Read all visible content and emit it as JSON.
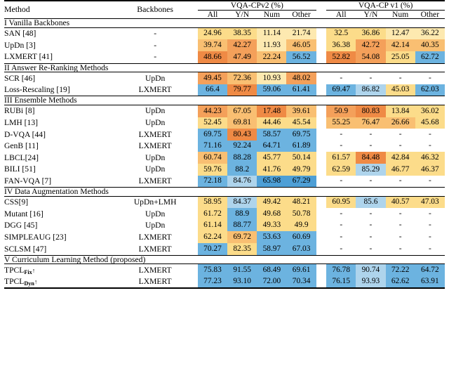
{
  "table": {
    "columns": {
      "method": "Method",
      "backbones": "Backbones",
      "group1": "VQA-CPv2 (%)",
      "group2": "VQA-CP v1 (%)",
      "sub": [
        "All",
        "Y/N",
        "Num",
        "Other"
      ]
    },
    "palette": {
      "yellow_light": "#fde9b0",
      "yellow": "#fcdc8a",
      "orange_light": "#f9bf72",
      "orange": "#f4a05a",
      "orange_deep": "#ef8a45",
      "blue_light": "#aed4ec",
      "blue": "#6cb3e0",
      "blue_deep": "#4e9fd6",
      "none": "transparent"
    },
    "sections": [
      {
        "title": "I Vanilla Backbones",
        "rows": [
          {
            "method": "SAN [48]",
            "backbone": "-",
            "v2": [
              "24.96",
              "38.35",
              "11.14",
              "21.74"
            ],
            "v2c": [
              "yellow",
              "yellow",
              "yellow_light",
              "yellow_light"
            ],
            "v1": [
              "32.5",
              "36.86",
              "12.47",
              "36.22"
            ],
            "v1c": [
              "yellow",
              "yellow",
              "yellow_light",
              "yellow_light"
            ]
          },
          {
            "method": "UpDn [3]",
            "backbone": "-",
            "v2": [
              "39.74",
              "42.27",
              "11.93",
              "46.05"
            ],
            "v2c": [
              "orange_light",
              "orange",
              "yellow_light",
              "orange_light"
            ],
            "v1": [
              "36.38",
              "42.72",
              "42.14",
              "40.35"
            ],
            "v1c": [
              "yellow",
              "orange",
              "orange_light",
              "orange_light"
            ]
          },
          {
            "method": "LXMERT [41]",
            "backbone": "-",
            "v2": [
              "48.66",
              "47.49",
              "22.24",
              "56.52"
            ],
            "v2c": [
              "orange_deep",
              "orange",
              "orange_light",
              "blue"
            ],
            "v1": [
              "52.82",
              "54.08",
              "25.05",
              "62.72"
            ],
            "v1c": [
              "orange_deep",
              "orange",
              "yellow",
              "blue"
            ]
          }
        ]
      },
      {
        "title": "II Answer Re-Ranking Methods",
        "rows": [
          {
            "method": "SCR [46]",
            "backbone": "UpDn",
            "v2": [
              "49.45",
              "72.36",
              "10.93",
              "48.02"
            ],
            "v2c": [
              "orange",
              "orange_light",
              "yellow_light",
              "orange"
            ],
            "v1": [
              "-",
              "-",
              "-",
              "-"
            ],
            "v1c": [
              "none",
              "none",
              "none",
              "none"
            ]
          },
          {
            "method": "Loss-Rescaling [19]",
            "backbone": "LXMERT",
            "v2": [
              "66.4",
              "79.77",
              "59.06",
              "61.41"
            ],
            "v2c": [
              "blue",
              "orange_deep",
              "blue",
              "blue"
            ],
            "v1": [
              "69.47",
              "86.82",
              "45.03",
              "62.03"
            ],
            "v1c": [
              "blue",
              "blue_light",
              "yellow",
              "blue"
            ]
          }
        ]
      },
      {
        "title": "III Ensemble Methods",
        "rows": [
          {
            "method": "RUBi [8]",
            "backbone": "UpDn",
            "v2": [
              "44.23",
              "67.05",
              "17.48",
              "39.61"
            ],
            "v2c": [
              "orange",
              "orange_light",
              "orange_deep",
              "orange_light"
            ],
            "v1": [
              "50.9",
              "80.83",
              "13.84",
              "36.02"
            ],
            "v1c": [
              "orange",
              "orange_deep",
              "yellow",
              "yellow"
            ]
          },
          {
            "method": "LMH [13]",
            "backbone": "UpDn",
            "v2": [
              "52.45",
              "69.81",
              "44.46",
              "45.54"
            ],
            "v2c": [
              "yellow",
              "orange_light",
              "yellow",
              "yellow"
            ],
            "v1": [
              "55.25",
              "76.47",
              "26.66",
              "45.68"
            ],
            "v1c": [
              "orange_light",
              "orange_light",
              "orange_light",
              "yellow"
            ]
          },
          {
            "method": "D-VQA [44]",
            "backbone": "LXMERT",
            "v2": [
              "69.75",
              "80.43",
              "58.57",
              "69.75"
            ],
            "v2c": [
              "blue",
              "orange_deep",
              "blue",
              "blue"
            ],
            "v1": [
              "-",
              "-",
              "-",
              "-"
            ],
            "v1c": [
              "none",
              "none",
              "none",
              "none"
            ]
          },
          {
            "method": "GenB [11]",
            "backbone": "LXMERT",
            "v2": [
              "71.16",
              "92.24",
              "64.71",
              "61.89"
            ],
            "v2c": [
              "blue",
              "blue",
              "blue",
              "blue"
            ],
            "v1": [
              "-",
              "-",
              "-",
              "-"
            ],
            "v1c": [
              "none",
              "none",
              "none",
              "none"
            ]
          },
          {
            "method": "LBCL[24]",
            "backbone": "UpDn",
            "v2": [
              "60.74",
              "88.28",
              "45.77",
              "50.14"
            ],
            "v2c": [
              "orange_light",
              "blue",
              "yellow",
              "yellow"
            ],
            "v1": [
              "61.57",
              "84.48",
              "42.84",
              "46.32"
            ],
            "v1c": [
              "yellow",
              "orange_deep",
              "yellow",
              "yellow"
            ]
          },
          {
            "method": "BILI [51]",
            "backbone": "UpDn",
            "v2": [
              "59.76",
              "88.2",
              "41.76",
              "49.79"
            ],
            "v2c": [
              "yellow",
              "blue",
              "yellow",
              "yellow"
            ],
            "v1": [
              "62.59",
              "85.29",
              "46.77",
              "46.37"
            ],
            "v1c": [
              "yellow",
              "blue_light",
              "yellow",
              "yellow"
            ]
          },
          {
            "method": "FAN-VQA [7]",
            "backbone": "LXMERT",
            "v2": [
              "72.18",
              "84.76",
              "65.98",
              "67.29"
            ],
            "v2c": [
              "blue",
              "blue_light",
              "blue_deep",
              "blue_deep"
            ],
            "v1": [
              "-",
              "-",
              "-",
              "-"
            ],
            "v1c": [
              "none",
              "none",
              "none",
              "none"
            ]
          }
        ]
      },
      {
        "title": "IV Data Augmentation Methods",
        "rows": [
          {
            "method": "CSS[9]",
            "backbone": "UpDn+LMH",
            "v2": [
              "58.95",
              "84.37",
              "49.42",
              "48.21"
            ],
            "v2c": [
              "yellow",
              "blue_light",
              "yellow",
              "yellow"
            ],
            "v1": [
              "60.95",
              "85.6",
              "40.57",
              "47.03"
            ],
            "v1c": [
              "yellow",
              "blue_light",
              "yellow",
              "yellow"
            ]
          },
          {
            "method": "Mutant [16]",
            "backbone": "UpDn",
            "v2": [
              "61.72",
              "88.9",
              "49.68",
              "50.78"
            ],
            "v2c": [
              "yellow",
              "blue",
              "yellow",
              "yellow"
            ],
            "v1": [
              "-",
              "-",
              "-",
              "-"
            ],
            "v1c": [
              "none",
              "none",
              "none",
              "none"
            ]
          },
          {
            "method": "DGG [45]",
            "backbone": "UpDn",
            "v2": [
              "61.14",
              "88.77",
              "49.33",
              "49.9"
            ],
            "v2c": [
              "yellow",
              "blue",
              "yellow",
              "yellow"
            ],
            "v1": [
              "-",
              "-",
              "-",
              "-"
            ],
            "v1c": [
              "none",
              "none",
              "none",
              "none"
            ]
          },
          {
            "method": "SIMPLEAUG [23]",
            "backbone": "LXMERT",
            "v2": [
              "62.24",
              "69.72",
              "53.63",
              "60.69"
            ],
            "v2c": [
              "yellow",
              "orange_light",
              "blue",
              "blue"
            ],
            "v1": [
              "-",
              "-",
              "-",
              "-"
            ],
            "v1c": [
              "none",
              "none",
              "none",
              "none"
            ]
          },
          {
            "method": "SCLSM [47]",
            "backbone": "LXMERT",
            "v2": [
              "70.27",
              "82.35",
              "58.97",
              "67.03"
            ],
            "v2c": [
              "blue",
              "yellow",
              "blue",
              "blue"
            ],
            "v1": [
              "-",
              "-",
              "-",
              "-"
            ],
            "v1c": [
              "none",
              "none",
              "none",
              "none"
            ]
          }
        ]
      },
      {
        "title": "V Curriculum Learning Method (proposed)",
        "rows": [
          {
            "method": "TPCL",
            "method_sub": "Fix",
            "method_arrow": "↑",
            "bold": true,
            "backbone": "LXMERT",
            "v2": [
              "75.83",
              "91.55",
              "68.49",
              "69.61"
            ],
            "v2c": [
              "blue",
              "blue",
              "blue",
              "blue"
            ],
            "v1": [
              "76.78",
              "90.74",
              "72.22",
              "64.72"
            ],
            "v1c": [
              "blue",
              "blue_light",
              "blue",
              "blue"
            ]
          },
          {
            "method": "TPCL",
            "method_sub": "Dyn",
            "method_arrow": "↑",
            "bold": true,
            "backbone": "LXMERT",
            "v2": [
              "77.23",
              "93.10",
              "72.00",
              "70.34"
            ],
            "v2c": [
              "blue",
              "blue",
              "blue",
              "blue"
            ],
            "v1": [
              "76.15",
              "93.93",
              "62.62",
              "63.91"
            ],
            "v1c": [
              "blue",
              "blue_light",
              "blue",
              "blue"
            ]
          }
        ]
      }
    ]
  }
}
